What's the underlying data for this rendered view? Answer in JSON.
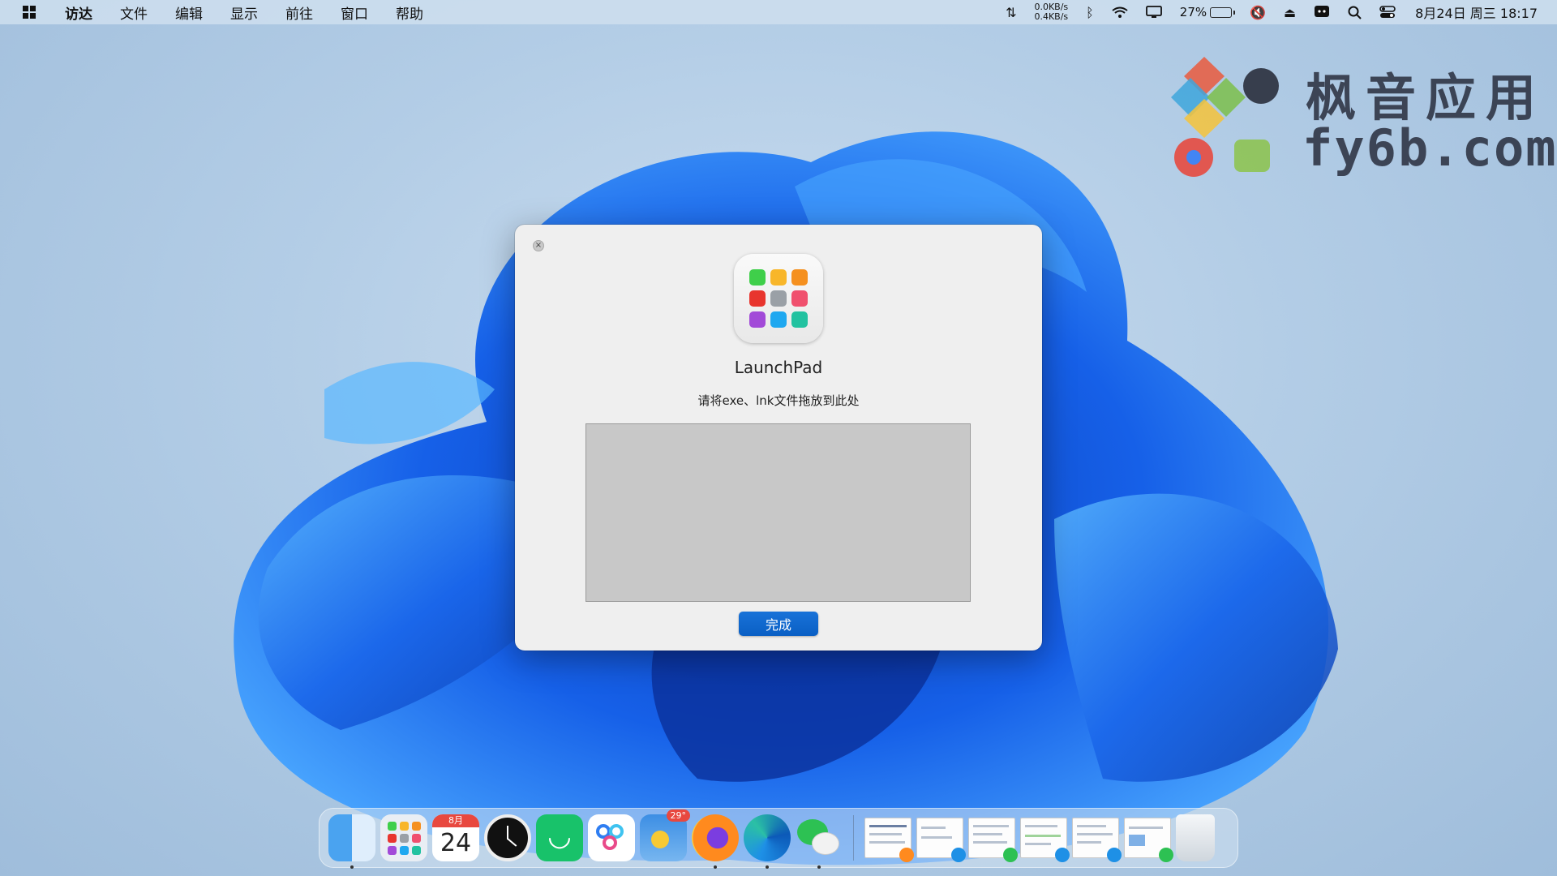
{
  "menubar": {
    "app_name": "访达",
    "menus": [
      "文件",
      "编辑",
      "显示",
      "前往",
      "窗口",
      "帮助"
    ],
    "net_up": "0.0KB/s",
    "net_down": "0.4KB/s",
    "battery_percent": "27%",
    "battery_level": 0.27,
    "datetime": "8月24日 周三 18:17"
  },
  "watermark": {
    "line1": "枫音应用",
    "line2": "fy6b.com"
  },
  "dialog": {
    "close_glyph": "×",
    "app_name": "LaunchPad",
    "instruction": "请将exe、lnk文件拖放到此处",
    "done_label": "完成",
    "icon_colors": [
      "#3fcf4a",
      "#f8b62a",
      "#f5901f",
      "#e8352e",
      "#9aa0a6",
      "#f0506e",
      "#a24ad8",
      "#1fa8f0",
      "#22c2a0"
    ]
  },
  "dock": {
    "calendar_month": "8月",
    "calendar_day": "24",
    "weather_badge": "29°",
    "apps": [
      {
        "name": "finder-app-icon",
        "running": true
      },
      {
        "name": "launchpad-app-icon",
        "running": false
      },
      {
        "name": "calendar-app-icon",
        "running": false
      },
      {
        "name": "clock-app-icon",
        "running": false
      },
      {
        "name": "green-chat-app-icon",
        "running": false
      },
      {
        "name": "baidu-netdisk-app-icon",
        "running": false
      },
      {
        "name": "weather-app-icon",
        "running": false
      },
      {
        "name": "firefox-app-icon",
        "running": true
      },
      {
        "name": "edge-app-icon",
        "running": true
      },
      {
        "name": "wechat-app-icon",
        "running": true
      }
    ]
  },
  "colors": {
    "accent": "#0a64c8",
    "wallpaper_blue": "#1559e0"
  }
}
